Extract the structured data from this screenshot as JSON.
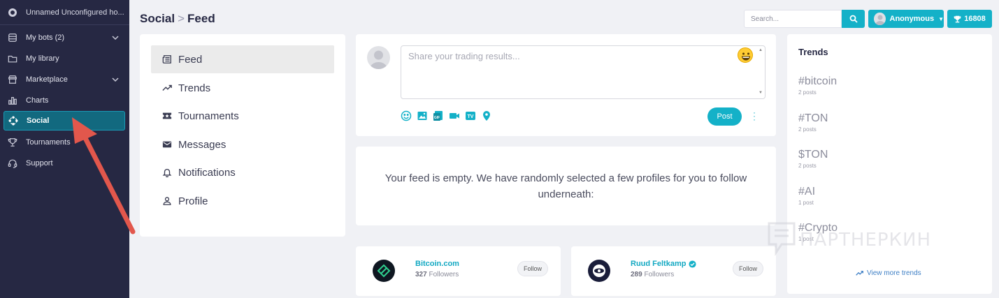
{
  "sidebar": {
    "workspace": "Unnamed Unconfigured ho...",
    "items": [
      {
        "label": "My bots (2)"
      },
      {
        "label": "My library"
      },
      {
        "label": "Marketplace"
      },
      {
        "label": "Charts"
      },
      {
        "label": "Social"
      },
      {
        "label": "Tournaments"
      },
      {
        "label": "Support"
      }
    ]
  },
  "header": {
    "breadcrumb_parent": "Social",
    "breadcrumb_sep": ">",
    "breadcrumb_current": "Feed",
    "search_placeholder": "Search...",
    "user_name": "Anonymous",
    "points": "16808"
  },
  "menu": {
    "items": [
      {
        "label": "Feed"
      },
      {
        "label": "Trends"
      },
      {
        "label": "Tournaments"
      },
      {
        "label": "Messages"
      },
      {
        "label": "Notifications"
      },
      {
        "label": "Profile"
      }
    ]
  },
  "composer": {
    "placeholder": "Share your trading results...",
    "post_label": "Post"
  },
  "feed": {
    "empty_message": "Your feed is empty. We have randomly selected a few profiles for you to follow underneath:"
  },
  "profiles": [
    {
      "name": "Bitcoin.com",
      "followers": "327",
      "followers_label": "Followers",
      "follow_label": "Follow",
      "verified": false
    },
    {
      "name": "Ruud Feltkamp",
      "followers": "289",
      "followers_label": "Followers",
      "follow_label": "Follow",
      "verified": true
    }
  ],
  "trends": {
    "title": "Trends",
    "items": [
      {
        "tag": "#bitcoin",
        "count": "2 posts"
      },
      {
        "tag": "#TON",
        "count": "2 posts"
      },
      {
        "tag": "$TON",
        "count": "2 posts"
      },
      {
        "tag": "#AI",
        "count": "1 post"
      },
      {
        "tag": "#Crypto",
        "count": "1 post"
      }
    ],
    "view_more": "View more trends"
  },
  "watermark": "ПАРТНЕРКИН",
  "colors": {
    "accent": "#14b1c8",
    "sidebar_bg": "#262843",
    "sidebar_active": "#12697f",
    "annotation_arrow": "#e2574c"
  }
}
